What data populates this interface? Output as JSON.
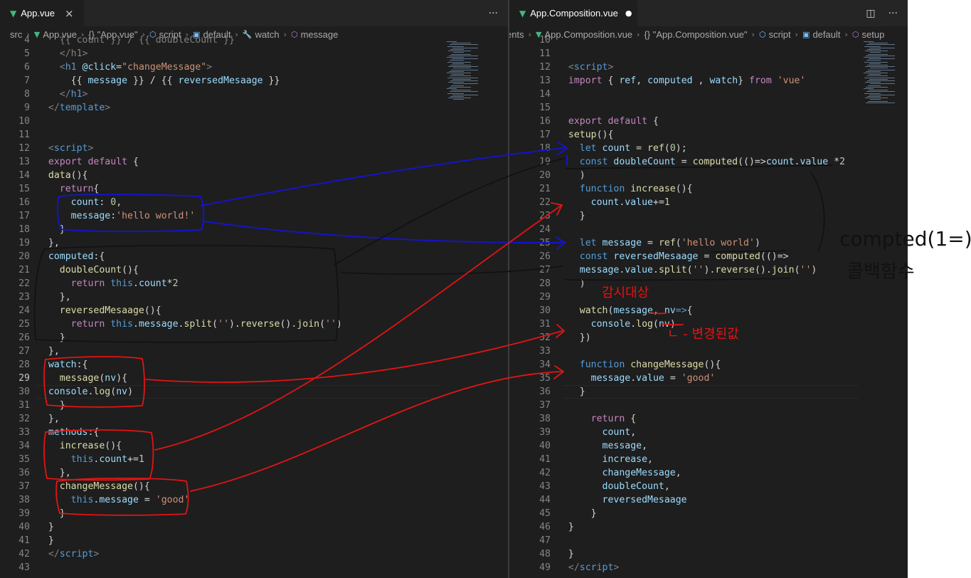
{
  "left": {
    "tab": {
      "label": "App.vue",
      "close": "×"
    },
    "actions": {
      "more": "···"
    },
    "breadcrumb": [
      "src",
      "App.vue",
      "{} \"App.vue\"",
      "script",
      "default",
      "watch",
      "message"
    ],
    "lines": [
      {
        "n": "4",
        "t": [
          [
            "g",
            "    {{ count }} / {{ doubleCount }}"
          ]
        ]
      },
      {
        "n": "5",
        "t": [
          [
            "g",
            "    </h1>"
          ]
        ]
      },
      {
        "n": "6",
        "t": [
          [
            "g",
            "    <"
          ],
          [
            "k",
            "h1"
          ],
          [
            "v",
            " @click"
          ],
          [
            "t",
            "="
          ],
          [
            "s",
            "\"changeMessage\""
          ],
          [
            "g",
            ">"
          ]
        ]
      },
      {
        "n": "7",
        "t": [
          [
            "t",
            "      {{ "
          ],
          [
            "v",
            "message"
          ],
          [
            "t",
            " }} / {{ "
          ],
          [
            "v",
            "reversedMesaage"
          ],
          [
            "t",
            " }}"
          ]
        ]
      },
      {
        "n": "8",
        "t": [
          [
            "g",
            "    </"
          ],
          [
            "k",
            "h1"
          ],
          [
            "g",
            ">"
          ]
        ]
      },
      {
        "n": "9",
        "t": [
          [
            "g",
            "  </"
          ],
          [
            "k",
            "template"
          ],
          [
            "g",
            ">"
          ]
        ]
      },
      {
        "n": "10",
        "t": []
      },
      {
        "n": "11",
        "t": []
      },
      {
        "n": "12",
        "t": [
          [
            "g",
            "  <"
          ],
          [
            "k",
            "script"
          ],
          [
            "g",
            ">"
          ]
        ]
      },
      {
        "n": "13",
        "t": [
          [
            "c",
            "  export default"
          ],
          [
            "t",
            " {"
          ]
        ]
      },
      {
        "n": "14",
        "t": [
          [
            "f",
            "  data"
          ],
          [
            "t",
            "(){"
          ]
        ]
      },
      {
        "n": "15",
        "t": [
          [
            "c",
            "    return"
          ],
          [
            "t",
            "{"
          ]
        ]
      },
      {
        "n": "16",
        "t": [
          [
            "v",
            "      count"
          ],
          [
            "t",
            ": "
          ],
          [
            "n",
            "0"
          ],
          [
            "t",
            ","
          ]
        ]
      },
      {
        "n": "17",
        "t": [
          [
            "v",
            "      message"
          ],
          [
            "t",
            ":"
          ],
          [
            "s",
            "'hello world!'"
          ]
        ]
      },
      {
        "n": "18",
        "t": [
          [
            "t",
            "    }"
          ]
        ]
      },
      {
        "n": "19",
        "t": [
          [
            "t",
            "  },"
          ]
        ]
      },
      {
        "n": "20",
        "t": [
          [
            "v",
            "  computed"
          ],
          [
            "t",
            ":{"
          ]
        ]
      },
      {
        "n": "21",
        "t": [
          [
            "f",
            "    doubleCount"
          ],
          [
            "t",
            "(){"
          ]
        ]
      },
      {
        "n": "22",
        "t": [
          [
            "c",
            "      return"
          ],
          [
            "k",
            " this"
          ],
          [
            "t",
            "."
          ],
          [
            "v",
            "count"
          ],
          [
            "t",
            "*"
          ],
          [
            "n",
            "2"
          ]
        ]
      },
      {
        "n": "23",
        "t": [
          [
            "t",
            "    },"
          ]
        ]
      },
      {
        "n": "24",
        "t": [
          [
            "f",
            "    reversedMesaage"
          ],
          [
            "t",
            "(){"
          ]
        ]
      },
      {
        "n": "25",
        "t": [
          [
            "c",
            "      return"
          ],
          [
            "k",
            " this"
          ],
          [
            "t",
            "."
          ],
          [
            "v",
            "message"
          ],
          [
            "t",
            "."
          ],
          [
            "f",
            "split"
          ],
          [
            "t",
            "("
          ],
          [
            "s",
            "''"
          ],
          [
            "t",
            ")."
          ],
          [
            "f",
            "reverse"
          ],
          [
            "t",
            "()."
          ],
          [
            "f",
            "join"
          ],
          [
            "t",
            "("
          ],
          [
            "s",
            "''"
          ],
          [
            "t",
            ")"
          ]
        ]
      },
      {
        "n": "26",
        "t": [
          [
            "t",
            "    }"
          ]
        ]
      },
      {
        "n": "27",
        "t": [
          [
            "t",
            "  },"
          ]
        ]
      },
      {
        "n": "28",
        "t": [
          [
            "v",
            "  watch"
          ],
          [
            "t",
            ":{"
          ]
        ]
      },
      {
        "n": "29",
        "t": [
          [
            "f",
            "    message"
          ],
          [
            "t",
            "("
          ],
          [
            "v",
            "nv"
          ],
          [
            "t",
            "){"
          ]
        ]
      },
      {
        "n": "30",
        "t": [
          [
            "v",
            "  console"
          ],
          [
            "t",
            "."
          ],
          [
            "f",
            "log"
          ],
          [
            "t",
            "("
          ],
          [
            "v",
            "nv"
          ],
          [
            "t",
            ")"
          ]
        ]
      },
      {
        "n": "31",
        "t": [
          [
            "t",
            "    }"
          ]
        ]
      },
      {
        "n": "32",
        "t": [
          [
            "t",
            "  },"
          ]
        ]
      },
      {
        "n": "33",
        "t": [
          [
            "v",
            "  methods"
          ],
          [
            "t",
            ":{"
          ]
        ]
      },
      {
        "n": "34",
        "t": [
          [
            "f",
            "    increase"
          ],
          [
            "t",
            "(){"
          ]
        ]
      },
      {
        "n": "35",
        "t": [
          [
            "k",
            "      this"
          ],
          [
            "t",
            "."
          ],
          [
            "v",
            "count"
          ],
          [
            "t",
            "+="
          ],
          [
            "n",
            "1"
          ]
        ]
      },
      {
        "n": "36",
        "t": [
          [
            "t",
            "    },"
          ]
        ]
      },
      {
        "n": "37",
        "t": [
          [
            "f",
            "    changeMessage"
          ],
          [
            "t",
            "(){"
          ]
        ]
      },
      {
        "n": "38",
        "t": [
          [
            "k",
            "      this"
          ],
          [
            "t",
            "."
          ],
          [
            "v",
            "message"
          ],
          [
            "t",
            " = "
          ],
          [
            "s",
            "'good'"
          ]
        ]
      },
      {
        "n": "39",
        "t": [
          [
            "t",
            "    }"
          ]
        ]
      },
      {
        "n": "40",
        "t": [
          [
            "t",
            "  }"
          ]
        ]
      },
      {
        "n": "41",
        "t": [
          [
            "t",
            "  }"
          ]
        ]
      },
      {
        "n": "42",
        "t": [
          [
            "g",
            "  </"
          ],
          [
            "k",
            "script"
          ],
          [
            "g",
            ">"
          ]
        ]
      },
      {
        "n": "43",
        "t": []
      }
    ]
  },
  "right": {
    "tab": {
      "label": "App.Composition.vue",
      "dirty": "●"
    },
    "actions": {
      "split": "◫",
      "more": "···"
    },
    "breadcrumb": [
      "ents",
      "App.Composition.vue",
      "{} \"App.Composition.vue\"",
      "script",
      "default",
      "setup"
    ],
    "lines": [
      {
        "n": "10",
        "t": []
      },
      {
        "n": "11",
        "t": []
      },
      {
        "n": "12",
        "t": [
          [
            "g",
            "  <"
          ],
          [
            "k",
            "script"
          ],
          [
            "g",
            ">"
          ]
        ]
      },
      {
        "n": "13",
        "t": [
          [
            "c",
            "  import"
          ],
          [
            "t",
            " { "
          ],
          [
            "v",
            "ref"
          ],
          [
            "t",
            ", "
          ],
          [
            "v",
            "computed"
          ],
          [
            "t",
            " , "
          ],
          [
            "v",
            "watch"
          ],
          [
            "t",
            "} "
          ],
          [
            "c",
            "from"
          ],
          [
            "s",
            " 'vue'"
          ]
        ]
      },
      {
        "n": "14",
        "t": []
      },
      {
        "n": "15",
        "t": []
      },
      {
        "n": "16",
        "t": [
          [
            "c",
            "  export default"
          ],
          [
            "t",
            " {"
          ]
        ]
      },
      {
        "n": "17",
        "t": [
          [
            "f",
            "  setup"
          ],
          [
            "t",
            "(){"
          ]
        ]
      },
      {
        "n": "18",
        "t": [
          [
            "k",
            "    let"
          ],
          [
            "v",
            " count"
          ],
          [
            "t",
            " = "
          ],
          [
            "f",
            "ref"
          ],
          [
            "t",
            "("
          ],
          [
            "n",
            "0"
          ],
          [
            "t",
            ");"
          ]
        ]
      },
      {
        "n": "19",
        "t": [
          [
            "k",
            "    const"
          ],
          [
            "v",
            " doubleCount"
          ],
          [
            "t",
            " = "
          ],
          [
            "f",
            "computed"
          ],
          [
            "t",
            "(()=>"
          ],
          [
            "v",
            "count"
          ],
          [
            "t",
            "."
          ],
          [
            "v",
            "value"
          ],
          [
            "t",
            " *"
          ],
          [
            "n",
            "2"
          ]
        ]
      },
      {
        "n": "20",
        "t": [
          [
            "t",
            "    )"
          ]
        ]
      },
      {
        "n": "21",
        "t": [
          [
            "k",
            "    function"
          ],
          [
            "f",
            " increase"
          ],
          [
            "t",
            "(){"
          ]
        ]
      },
      {
        "n": "22",
        "t": [
          [
            "v",
            "      count"
          ],
          [
            "t",
            "."
          ],
          [
            "v",
            "value"
          ],
          [
            "t",
            "+="
          ],
          [
            "n",
            "1"
          ]
        ]
      },
      {
        "n": "23",
        "t": [
          [
            "t",
            "    }"
          ]
        ]
      },
      {
        "n": "24",
        "t": []
      },
      {
        "n": "25",
        "t": [
          [
            "k",
            "    let"
          ],
          [
            "v",
            " message"
          ],
          [
            "t",
            " = "
          ],
          [
            "f",
            "ref"
          ],
          [
            "t",
            "("
          ],
          [
            "s",
            "'hello world'"
          ],
          [
            "t",
            ")"
          ]
        ]
      },
      {
        "n": "26",
        "t": [
          [
            "k",
            "    const"
          ],
          [
            "v",
            " reversedMesaage"
          ],
          [
            "t",
            " = "
          ],
          [
            "f",
            "computed"
          ],
          [
            "t",
            "(()=>"
          ]
        ]
      },
      {
        "n": "27",
        "t": [
          [
            "v",
            "    message"
          ],
          [
            "t",
            "."
          ],
          [
            "v",
            "value"
          ],
          [
            "t",
            "."
          ],
          [
            "f",
            "split"
          ],
          [
            "t",
            "("
          ],
          [
            "s",
            "''"
          ],
          [
            "t",
            ")."
          ],
          [
            "f",
            "reverse"
          ],
          [
            "t",
            "()."
          ],
          [
            "f",
            "join"
          ],
          [
            "t",
            "("
          ],
          [
            "s",
            "''"
          ],
          [
            "t",
            ")"
          ]
        ]
      },
      {
        "n": "28",
        "t": [
          [
            "t",
            "    )"
          ]
        ]
      },
      {
        "n": "29",
        "t": []
      },
      {
        "n": "30",
        "t": [
          [
            "f",
            "    watch"
          ],
          [
            "t",
            "("
          ],
          [
            "v",
            "message"
          ],
          [
            "t",
            ", "
          ],
          [
            "v",
            "nv"
          ],
          [
            "k",
            "=>"
          ],
          [
            "t",
            "{"
          ]
        ]
      },
      {
        "n": "31",
        "t": [
          [
            "v",
            "      console"
          ],
          [
            "t",
            "."
          ],
          [
            "f",
            "log"
          ],
          [
            "t",
            "("
          ],
          [
            "v",
            "nv"
          ],
          [
            "t",
            ")"
          ]
        ]
      },
      {
        "n": "32",
        "t": [
          [
            "t",
            "    })"
          ]
        ]
      },
      {
        "n": "33",
        "t": []
      },
      {
        "n": "34",
        "t": [
          [
            "k",
            "    function"
          ],
          [
            "f",
            " changeMessage"
          ],
          [
            "t",
            "(){"
          ]
        ]
      },
      {
        "n": "35",
        "t": [
          [
            "v",
            "      message"
          ],
          [
            "t",
            "."
          ],
          [
            "v",
            "value"
          ],
          [
            "t",
            " = "
          ],
          [
            "s",
            "'good'"
          ]
        ]
      },
      {
        "n": "36",
        "t": [
          [
            "t",
            "    }"
          ]
        ]
      },
      {
        "n": "37",
        "t": []
      },
      {
        "n": "38",
        "t": [
          [
            "c",
            "      return"
          ],
          [
            "t",
            " {"
          ]
        ]
      },
      {
        "n": "39",
        "t": [
          [
            "v",
            "        count"
          ],
          [
            "t",
            ","
          ]
        ]
      },
      {
        "n": "40",
        "t": [
          [
            "v",
            "        message"
          ],
          [
            "t",
            ","
          ]
        ]
      },
      {
        "n": "41",
        "t": [
          [
            "v",
            "        increase"
          ],
          [
            "t",
            ","
          ]
        ]
      },
      {
        "n": "42",
        "t": [
          [
            "v",
            "        changeMessage"
          ],
          [
            "t",
            ","
          ]
        ]
      },
      {
        "n": "43",
        "t": [
          [
            "v",
            "        doubleCount"
          ],
          [
            "t",
            ","
          ]
        ]
      },
      {
        "n": "44",
        "t": [
          [
            "v",
            "        reversedMesaage"
          ]
        ]
      },
      {
        "n": "45",
        "t": [
          [
            "t",
            "      }"
          ]
        ]
      },
      {
        "n": "46",
        "t": [
          [
            "t",
            "  }"
          ]
        ]
      },
      {
        "n": "47",
        "t": []
      },
      {
        "n": "48",
        "t": [
          [
            "t",
            "  }"
          ]
        ]
      },
      {
        "n": "49",
        "t": [
          [
            "g",
            "  </"
          ],
          [
            "k",
            "script"
          ],
          [
            "g",
            ">"
          ]
        ]
      }
    ]
  },
  "annotations": {
    "computed_note": "compted(1=)",
    "callback_note": "콜백함수",
    "watch_target_note": "감시대상",
    "new_value_note": "ㄴ - 변경된값",
    "ink_red": "#e31414",
    "ink_blue": "#1414c8",
    "ink_black": "#111111"
  },
  "theme": {
    "editor_bg": "#1e1e1e",
    "tab_bg": "#252526"
  }
}
